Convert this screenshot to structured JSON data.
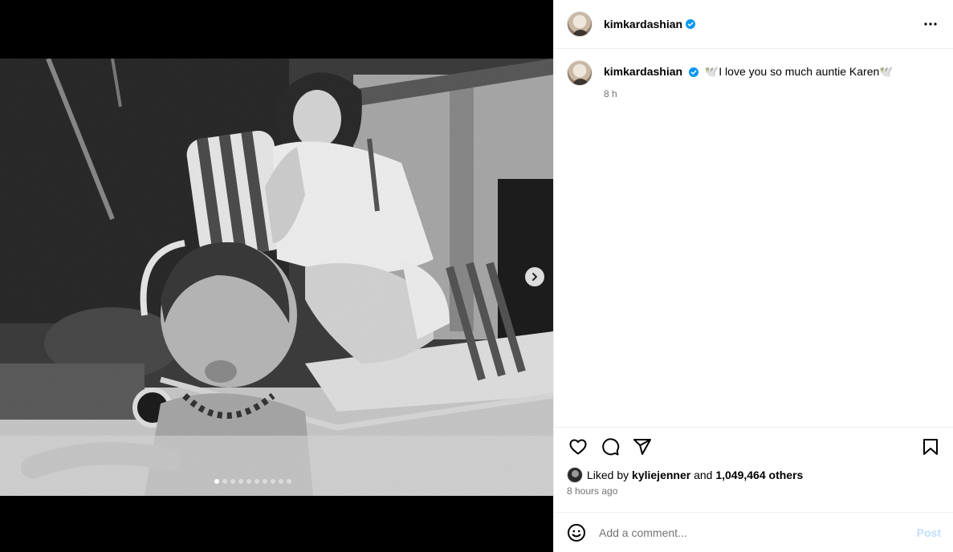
{
  "post": {
    "username": "kimkardashian",
    "caption_text": "🕊️I love you so much auntie Karen🕊️",
    "caption_time": "8 h",
    "liked_by_prefix": "Liked by",
    "liked_by_user": "kyliejenner",
    "liked_by_and": "and",
    "liked_by_others": "1,049,464 others",
    "post_time": "8 hours ago"
  },
  "carousel": {
    "total_slides": 10,
    "active_slide": 1
  },
  "comment": {
    "placeholder": "Add a comment...",
    "post_label": "Post"
  },
  "icons": {
    "verified": "verified-badge-icon",
    "more": "more-options-icon",
    "like": "heart-icon",
    "comment": "comment-bubble-icon",
    "share": "paper-plane-icon",
    "save": "bookmark-icon",
    "emoji": "smiley-icon",
    "next": "chevron-right-icon"
  },
  "colors": {
    "verified_blue": "#0095f6",
    "post_button_disabled": "#c0dffd",
    "secondary_text": "#737373"
  }
}
